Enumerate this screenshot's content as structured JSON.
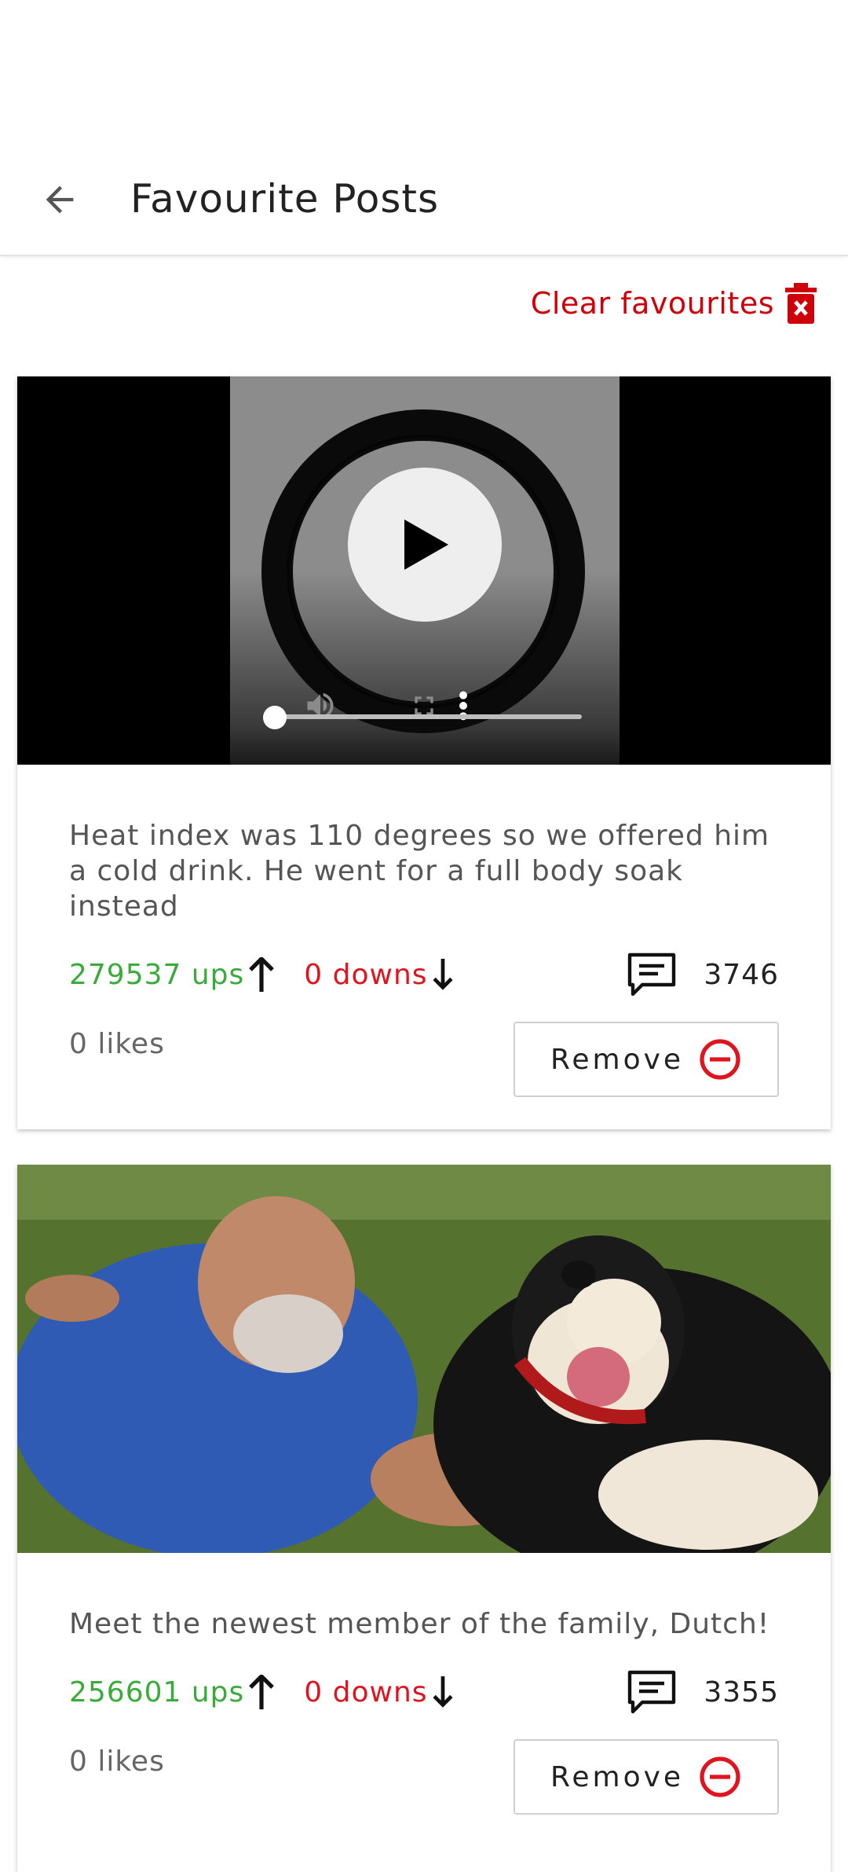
{
  "app_bar": {
    "title": "Favourite Posts"
  },
  "actions": {
    "clear_label": "Clear favourites"
  },
  "posts": [
    {
      "media_type": "video",
      "description": "Heat index was 110 degrees so we offered him a cold drink. He went for a full body soak instead",
      "ups": "279537 ups",
      "downs": "0 downs",
      "comments": "3746",
      "likes": "0 likes",
      "remove_label": "Remove",
      "seek_progress": 0
    },
    {
      "media_type": "image",
      "description": "Meet the newest member of the family, Dutch!",
      "ups": "256601 ups",
      "downs": "0 downs",
      "comments": "3355",
      "likes": "0 likes",
      "remove_label": "Remove"
    }
  ],
  "colors": {
    "accent_red": "#d0000b",
    "ups_green": "#3aaa3a",
    "downs_red": "#e0141e"
  }
}
